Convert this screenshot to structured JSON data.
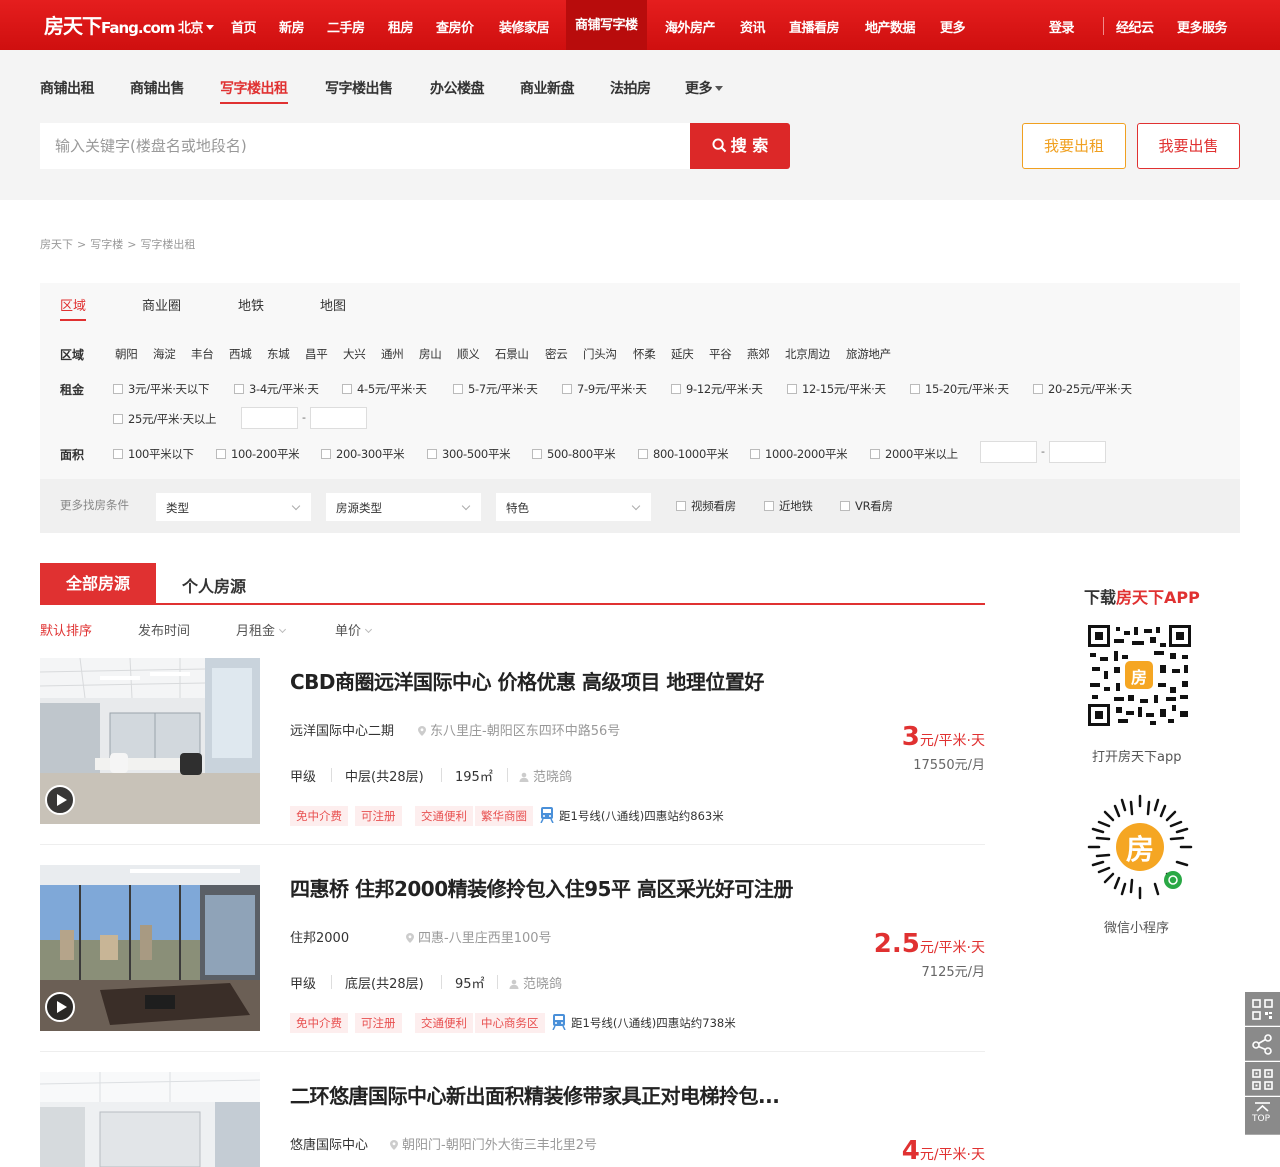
{
  "header": {
    "logo": "房天下",
    "logo_suffix": "Fang.com",
    "city": "北京",
    "nav": [
      "首页",
      "新房",
      "二手房",
      "租房",
      "查房价",
      "装修家居",
      "商铺写字楼",
      "海外房产",
      "资讯",
      "直播看房",
      "地产数据",
      "更多"
    ],
    "active_nav": "商铺写字楼",
    "login": "登录",
    "broker_cloud": "经纪云",
    "more_services": "更多服务"
  },
  "subnav": {
    "items": [
      "商铺出租",
      "商铺出售",
      "写字楼出租",
      "写字楼出售",
      "办公楼盘",
      "商业新盘",
      "法拍房",
      "更多"
    ],
    "active": "写字楼出租"
  },
  "search": {
    "placeholder": "输入关键字(楼盘名或地段名)",
    "button": "搜 索",
    "rent_button": "我要出租",
    "sell_button": "我要出售"
  },
  "breadcrumb": [
    "房天下",
    ">",
    "写字楼",
    ">",
    "写字楼出租"
  ],
  "filter": {
    "tabs": [
      "区域",
      "商业圈",
      "地铁",
      "地图"
    ],
    "active_tab": "区域",
    "district_label": "区域",
    "districts": [
      "朝阳",
      "海淀",
      "丰台",
      "西城",
      "东城",
      "昌平",
      "大兴",
      "通州",
      "房山",
      "顺义",
      "石景山",
      "密云",
      "门头沟",
      "怀柔",
      "延庆",
      "平谷",
      "燕郊",
      "北京周边",
      "旅游地产"
    ],
    "rent_label": "租金",
    "rents": [
      "3元/平米·天以下",
      "3-4元/平米·天",
      "4-5元/平米·天",
      "5-7元/平米·天",
      "7-9元/平米·天",
      "9-12元/平米·天",
      "12-15元/平米·天",
      "15-20元/平米·天",
      "20-25元/平米·天",
      "25元/平米·天以上"
    ],
    "area_label": "面积",
    "areas": [
      "100平米以下",
      "100-200平米",
      "200-300平米",
      "300-500平米",
      "500-800平米",
      "800-1000平米",
      "1000-2000平米",
      "2000平米以上"
    ],
    "range_dash": "-",
    "more_label": "更多找房条件",
    "selects": [
      "类型",
      "房源类型",
      "特色"
    ],
    "checks": [
      "视频看房",
      "近地铁",
      "VR看房"
    ]
  },
  "list_tabs": {
    "all": "全部房源",
    "personal": "个人房源"
  },
  "sort": [
    "默认排序",
    "发布时间",
    "月租金",
    "单价"
  ],
  "listings": [
    {
      "title": "CBD商圈远洋国际中心 价格优惠 高级项目 地理位置好",
      "building": "远洋国际中心二期",
      "location": "东八里庄-朝阳区东四环中路56号",
      "grade": "甲级",
      "floor": "中层(共28层)",
      "area": "195㎡",
      "agent": "范晓鸽",
      "tags": [
        "免中介费",
        "可注册",
        "交通便利",
        "繁华商圈"
      ],
      "metro": "距1号线(八通线)四惠站约863米",
      "price": "3",
      "price_unit": "元/平米·天",
      "monthly": "17550元/月"
    },
    {
      "title": "四惠桥 住邦2000精装修拎包入住95平 高区采光好可注册",
      "building": "住邦2000",
      "location": "四惠-八里庄西里100号",
      "grade": "甲级",
      "floor": "底层(共28层)",
      "area": "95㎡",
      "agent": "范晓鸽",
      "tags": [
        "免中介费",
        "可注册",
        "交通便利",
        "中心商务区"
      ],
      "metro": "距1号线(八通线)四惠站约738米",
      "price": "2.5",
      "price_unit": "元/平米·天",
      "monthly": "7125元/月"
    },
    {
      "title": "二环悠唐国际中心新出面积精装修带家具正对电梯拎包...",
      "building": "悠唐国际中心",
      "location": "朝阳门-朝阳门外大街三丰北里2号",
      "price": "4",
      "price_unit": "元/平米·天"
    }
  ],
  "sidebar": {
    "download_prefix": "下载",
    "download_brand": "房天下APP",
    "qr_label": "打开房天下app",
    "qr_badge": "房",
    "mini_label": "微信小程序",
    "mini_badge": "房",
    "top_label": "TOP"
  },
  "colors": {
    "brand_red": "#e03131",
    "nav_red": "#d91818",
    "orange": "#f0a020"
  }
}
